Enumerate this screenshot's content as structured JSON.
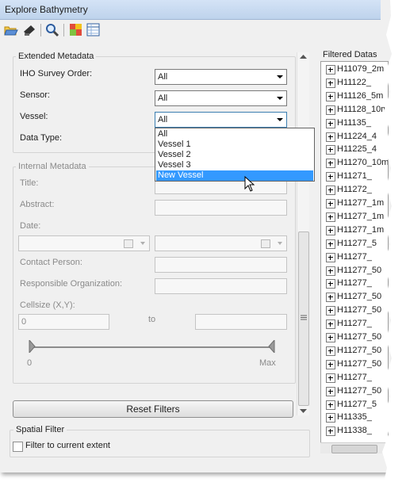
{
  "window": {
    "title": "Explore Bathymetry"
  },
  "toolbar": {
    "icons": [
      "open-folder-icon",
      "save-icon",
      "zoom-icon",
      "layer-icon",
      "table-icon"
    ]
  },
  "extended": {
    "legend": "Extended Metadata",
    "iho_label": "IHO Survey Order:",
    "iho_value": "All",
    "sensor_label": "Sensor:",
    "sensor_value": "All",
    "vessel_label": "Vessel:",
    "vessel_value": "All",
    "datatype_label": "Data Type:",
    "vessel_options": [
      "All",
      "Vessel 1",
      "Vessel 2",
      "Vessel 3",
      "New Vessel"
    ],
    "vessel_highlighted": "New Vessel"
  },
  "internal": {
    "legend": "Internal Metadata",
    "title_label": "Title:",
    "abstract_label": "Abstract:",
    "date_label": "Date:",
    "contact_label": "Contact Person:",
    "org_label": "Responsible Organization:",
    "cellsize_label": "Cellsize (X,Y):",
    "cellsize_from": "0",
    "to_label": "to",
    "slider_min": "0",
    "slider_max": "Max"
  },
  "reset_button": "Reset Filters",
  "spatial": {
    "legend": "Spatial Filter",
    "checkbox_label": "Filter to current extent",
    "checked": false
  },
  "filtered": {
    "header": "Filtered Datas",
    "items": [
      "H11079_2m",
      "H11122_",
      "H11126_5m",
      "H11128_10m",
      "H11135_",
      "H11224_4",
      "H11225_4",
      "H11270_10m",
      "H11271_",
      "H11272_",
      "H11277_1m",
      "H11277_1m",
      "H11277_1m",
      "H11277_5",
      "H11277_",
      "H11277_50",
      "H11277_",
      "H11277_50",
      "H11277_50",
      "H11277_",
      "H11277_50",
      "H11277_50",
      "H11277_50",
      "H11277_",
      "H11277_50",
      "H11277_5",
      "H11335_",
      "H11338_"
    ]
  }
}
